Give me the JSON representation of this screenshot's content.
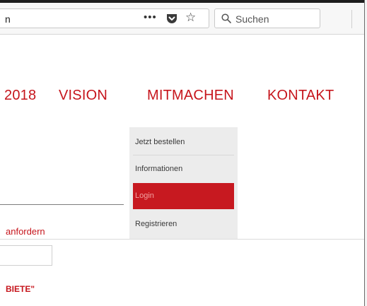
{
  "browser": {
    "url_fragment": "n",
    "more_actions": "•••",
    "search_placeholder": "Suchen"
  },
  "nav": {
    "items": [
      {
        "label": "2018"
      },
      {
        "label": "VISION"
      },
      {
        "label": "MITMACHEN"
      },
      {
        "label": "KONTAKT"
      }
    ]
  },
  "dropdown": {
    "items": [
      {
        "label": "Jetzt bestellen"
      },
      {
        "label": "Informationen"
      },
      {
        "label": "Login",
        "active": true
      },
      {
        "label": "Registrieren"
      }
    ]
  },
  "content": {
    "request_link": "anfordern",
    "heading_fragment": "BIETE\""
  },
  "colors": {
    "accent": "#c6151c",
    "dropdown_bg": "#ececec",
    "active_item_bg": "#c71920"
  }
}
